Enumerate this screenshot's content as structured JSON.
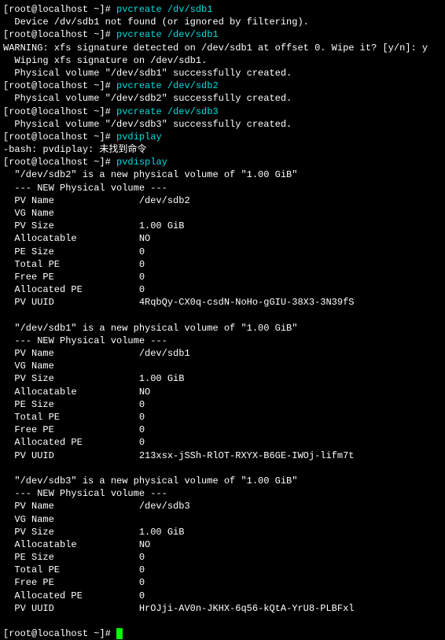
{
  "lines": {
    "l1_prompt": "[root@localhost ~]# ",
    "l1_cmd": "pvcreate /dv/sdb1",
    "l2": "  Device /dv/sdb1 not found (or ignored by filtering).",
    "l3_prompt": "[root@localhost ~]# ",
    "l3_cmd": "pvcreate /dev/sdb1",
    "l4": "WARNING: xfs signature detected on /dev/sdb1 at offset 0. Wipe it? [y/n]: y",
    "l5": "  Wiping xfs signature on /dev/sdb1.",
    "l6": "  Physical volume \"/dev/sdb1\" successfully created.",
    "l7_prompt": "[root@localhost ~]# ",
    "l7_cmd": "pvcreate /dev/sdb2",
    "l8": "  Physical volume \"/dev/sdb2\" successfully created.",
    "l9_prompt": "[root@localhost ~]# ",
    "l9_cmd": "pvcreate /dev/sdb3",
    "l10": "  Physical volume \"/dev/sdb3\" successfully created.",
    "l11_prompt": "[root@localhost ~]# ",
    "l11_cmd": "pvdiplay",
    "l12": "-bash: pvdiplay: 未找到命令",
    "l13_prompt": "[root@localhost ~]# ",
    "l13_cmd": "pvdisplay",
    "l14": "  \"/dev/sdb2\" is a new physical volume of \"1.00 GiB\"",
    "l15": "  --- NEW Physical volume ---",
    "l16": "  PV Name               /dev/sdb2",
    "l17": "  VG Name               ",
    "l18": "  PV Size               1.00 GiB",
    "l19": "  Allocatable           NO",
    "l20": "  PE Size               0   ",
    "l21": "  Total PE              0",
    "l22": "  Free PE               0",
    "l23": "  Allocated PE          0",
    "l24": "  PV UUID               4RqbQy-CX0q-csdN-NoHo-gGIU-38X3-3N39fS",
    "l25": "   ",
    "l26": "  \"/dev/sdb1\" is a new physical volume of \"1.00 GiB\"",
    "l27": "  --- NEW Physical volume ---",
    "l28": "  PV Name               /dev/sdb1",
    "l29": "  VG Name               ",
    "l30": "  PV Size               1.00 GiB",
    "l31": "  Allocatable           NO",
    "l32": "  PE Size               0   ",
    "l33": "  Total PE              0",
    "l34": "  Free PE               0",
    "l35": "  Allocated PE          0",
    "l36": "  PV UUID               213xsx-jSSh-RlOT-RXYX-B6GE-IWOj-lifm7t",
    "l37": "   ",
    "l38": "  \"/dev/sdb3\" is a new physical volume of \"1.00 GiB\"",
    "l39": "  --- NEW Physical volume ---",
    "l40": "  PV Name               /dev/sdb3",
    "l41": "  VG Name               ",
    "l42": "  PV Size               1.00 GiB",
    "l43": "  Allocatable           NO",
    "l44": "  PE Size               0   ",
    "l45": "  Total PE              0",
    "l46": "  Free PE               0",
    "l47": "  Allocated PE          0",
    "l48": "  PV UUID               HrOJji-AV0n-JKHX-6q56-kQtA-YrU8-PLBFxl",
    "l49": "   ",
    "l50_prompt": "[root@localhost ~]# "
  }
}
